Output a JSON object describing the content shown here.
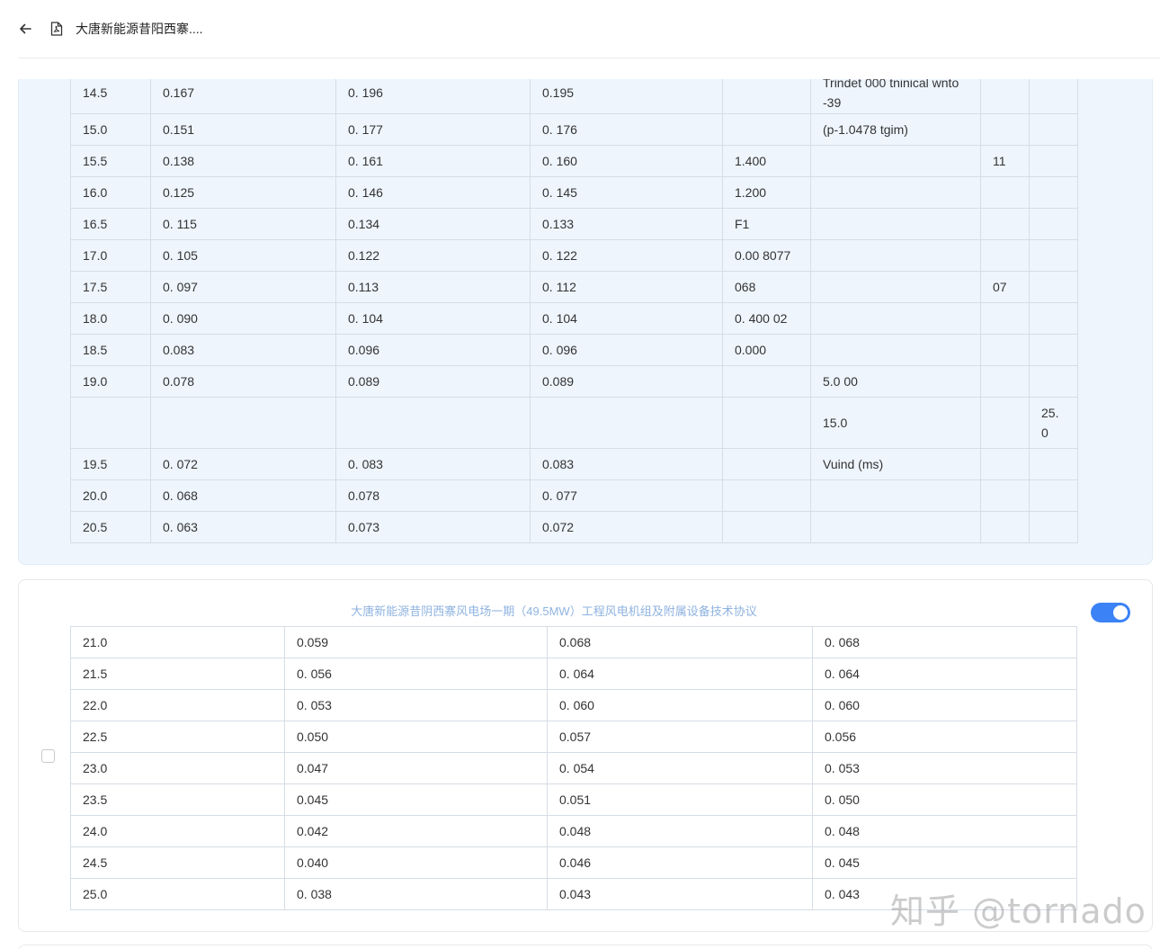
{
  "header": {
    "title": "大唐新能源昔阳西寨....",
    "back_icon": "arrow-left-icon",
    "file_icon": "pdf-file-icon"
  },
  "table_top": {
    "rows": [
      [
        "14.5",
        "0.167",
        "0. 196",
        "0.195",
        "",
        "Trindet 000 tninical wnto|-39",
        "",
        ""
      ],
      [
        "15.0",
        "0.151",
        "0. 177",
        "0. 176",
        "",
        "(p-1.0478 tgim)",
        "",
        ""
      ],
      [
        "15.5",
        "0.138",
        "0. 161",
        "0. 160",
        "1.400",
        "",
        "11",
        ""
      ],
      [
        "16.0",
        "0.125",
        "0. 146",
        "0. 145",
        "1.200",
        "",
        "",
        ""
      ],
      [
        "16.5",
        "0. 115",
        "0.134",
        "0.133",
        "F1",
        "",
        "",
        ""
      ],
      [
        "17.0",
        "0. 105",
        "0.122",
        "0. 122",
        "0.00 8077",
        "",
        "",
        ""
      ],
      [
        "17.5",
        "0. 097",
        "0.113",
        "0. 112",
        "068",
        "",
        "07",
        ""
      ],
      [
        "18.0",
        "0. 090",
        "0. 104",
        "0. 104",
        "0. 400 02",
        "",
        "",
        ""
      ],
      [
        "18.5",
        "0.083",
        "0.096",
        "0. 096",
        "0.000",
        "",
        "",
        ""
      ],
      [
        "19.0",
        "0.078",
        "0.089",
        "0.089",
        "",
        "5.0 00",
        "",
        ""
      ],
      [
        "",
        "",
        "",
        "",
        "",
        "15.0",
        "",
        "25.|0"
      ],
      [
        "19.5",
        "0. 072",
        "0. 083",
        "0.083",
        "",
        "Vuind (ms)",
        "",
        ""
      ],
      [
        "20.0",
        "0. 068",
        "0.078",
        "0. 077",
        "",
        "",
        "",
        ""
      ],
      [
        "20.5",
        "0. 063",
        "0.073",
        "0.072",
        "",
        "",
        "",
        ""
      ]
    ]
  },
  "page2": {
    "doc_title": "大唐新能源昔阴西寨风电场一期（49.5MW）工程风电机组及附属设备技术协议",
    "rows": [
      [
        "21.0",
        "0.059",
        "0.068",
        "0. 068"
      ],
      [
        "21.5",
        "0. 056",
        "0. 064",
        "0. 064"
      ],
      [
        "22.0",
        "0. 053",
        "0. 060",
        "0. 060"
      ],
      [
        "22.5",
        "0.050",
        "0.057",
        "0.056"
      ],
      [
        "23.0",
        "0.047",
        "0. 054",
        "0. 053"
      ],
      [
        "23.5",
        "0.045",
        "0.051",
        "0. 050"
      ],
      [
        "24.0",
        "0.042",
        "0.048",
        "0. 048"
      ],
      [
        "24.5",
        "0.040",
        "0.046",
        "0. 045"
      ],
      [
        "25.0",
        "0. 038",
        "0.043",
        "0. 043"
      ]
    ]
  },
  "watermark": "知乎 @tornado",
  "colors": {
    "card_bg": "#eef5fd",
    "accent": "#3b82f6",
    "doc_title": "#8fb3e0"
  }
}
